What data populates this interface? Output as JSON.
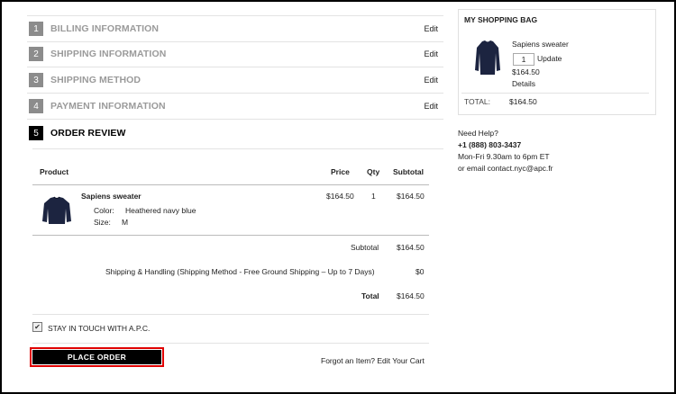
{
  "steps": [
    {
      "num": "1",
      "label": "BILLING INFORMATION",
      "edit": "Edit"
    },
    {
      "num": "2",
      "label": "SHIPPING INFORMATION",
      "edit": "Edit"
    },
    {
      "num": "3",
      "label": "SHIPPING METHOD",
      "edit": "Edit"
    },
    {
      "num": "4",
      "label": "PAYMENT INFORMATION",
      "edit": "Edit"
    },
    {
      "num": "5",
      "label": "ORDER REVIEW"
    }
  ],
  "review": {
    "headers": {
      "product": "Product",
      "price": "Price",
      "qty": "Qty",
      "subtotal": "Subtotal"
    },
    "item": {
      "name": "Sapiens sweater",
      "color_label": "Color:",
      "color_value": "Heathered navy blue",
      "size_label": "Size:",
      "size_value": "M",
      "price": "$164.50",
      "qty": "1",
      "subtotal": "$164.50"
    },
    "totals": {
      "subtotal_label": "Subtotal",
      "subtotal_value": "$164.50",
      "shipping_label": "Shipping & Handling (Shipping Method - Free Ground Shipping – Up to 7 Days)",
      "shipping_value": "$0",
      "total_label": "Total",
      "total_value": "$164.50"
    },
    "newsletter_label": "STAY IN TOUCH WITH A.P.C.",
    "newsletter_checked": true,
    "place_order": "PLACE ORDER",
    "forgot_link": "Forgot an Item? Edit Your Cart"
  },
  "bag": {
    "title": "MY SHOPPING BAG",
    "item_name": "Sapiens sweater",
    "qty": "1",
    "update": "Update",
    "price": "$164.50",
    "details": "Details",
    "total_label": "TOTAL:",
    "total_value": "$164.50"
  },
  "help": {
    "title": "Need Help?",
    "phone": "+1 (888) 803-3437",
    "hours": "Mon-Fri 9.30am to 6pm ET",
    "email": "or email contact.nyc@apc.fr"
  },
  "colors": {
    "accent_red": "#e00000",
    "step_inactive": "#8c8c8c",
    "step_active": "#000000"
  },
  "icons": {
    "sweater": "sweater-icon",
    "checkbox": "check-icon"
  }
}
